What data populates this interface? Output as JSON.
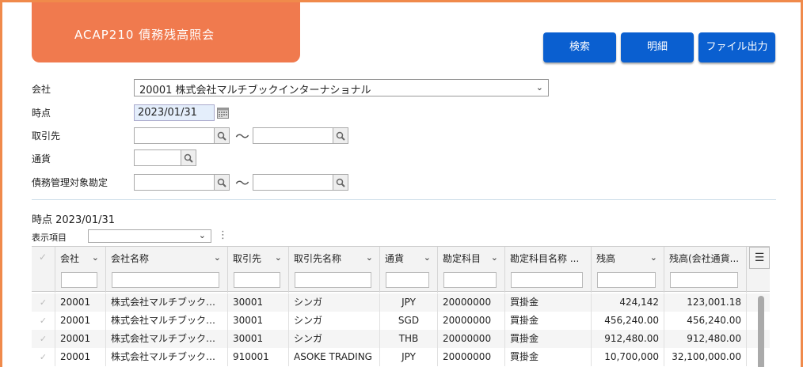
{
  "title": "ACAP210 債務残高照会",
  "buttons": {
    "search": "検索",
    "detail": "明細",
    "file_output": "ファイル出力"
  },
  "form": {
    "company_label": "会社",
    "company_value": "20001 株式会社マルチブックインターナショナル",
    "timepoint_label": "時点",
    "timepoint_value": "2023/01/31",
    "partner_label": "取引先",
    "currency_label": "通貨",
    "target_account_label": "債務管理対象勘定",
    "range_separator": "〜"
  },
  "result": {
    "timepoint_text": "時点 2023/01/31",
    "display_items_label": "表示項目"
  },
  "table": {
    "columns": [
      "会社",
      "会社名称",
      "取引先",
      "取引先名称",
      "通貨",
      "勘定科目",
      "勘定科目名称 ...",
      "残高",
      "残高(会社通貨..."
    ],
    "rows": [
      [
        "20001",
        "株式会社マルチブック…",
        "30001",
        "シンガ",
        "JPY",
        "20000000",
        "買掛金",
        "424,142",
        "123,001.18"
      ],
      [
        "20001",
        "株式会社マルチブック…",
        "30001",
        "シンガ",
        "SGD",
        "20000000",
        "買掛金",
        "456,240.00",
        "456,240.00"
      ],
      [
        "20001",
        "株式会社マルチブック…",
        "30001",
        "シンガ",
        "THB",
        "20000000",
        "買掛金",
        "912,480.00",
        "912,480.00"
      ],
      [
        "20001",
        "株式会社マルチブック…",
        "910001",
        "ASOKE TRADING",
        "JPY",
        "20000000",
        "買掛金",
        "10,700,000",
        "32,100,000.00"
      ]
    ]
  },
  "colors": {
    "accent": "#f07a4e",
    "button": "#0a5fd0",
    "row_alt": "#f5f5f5"
  }
}
